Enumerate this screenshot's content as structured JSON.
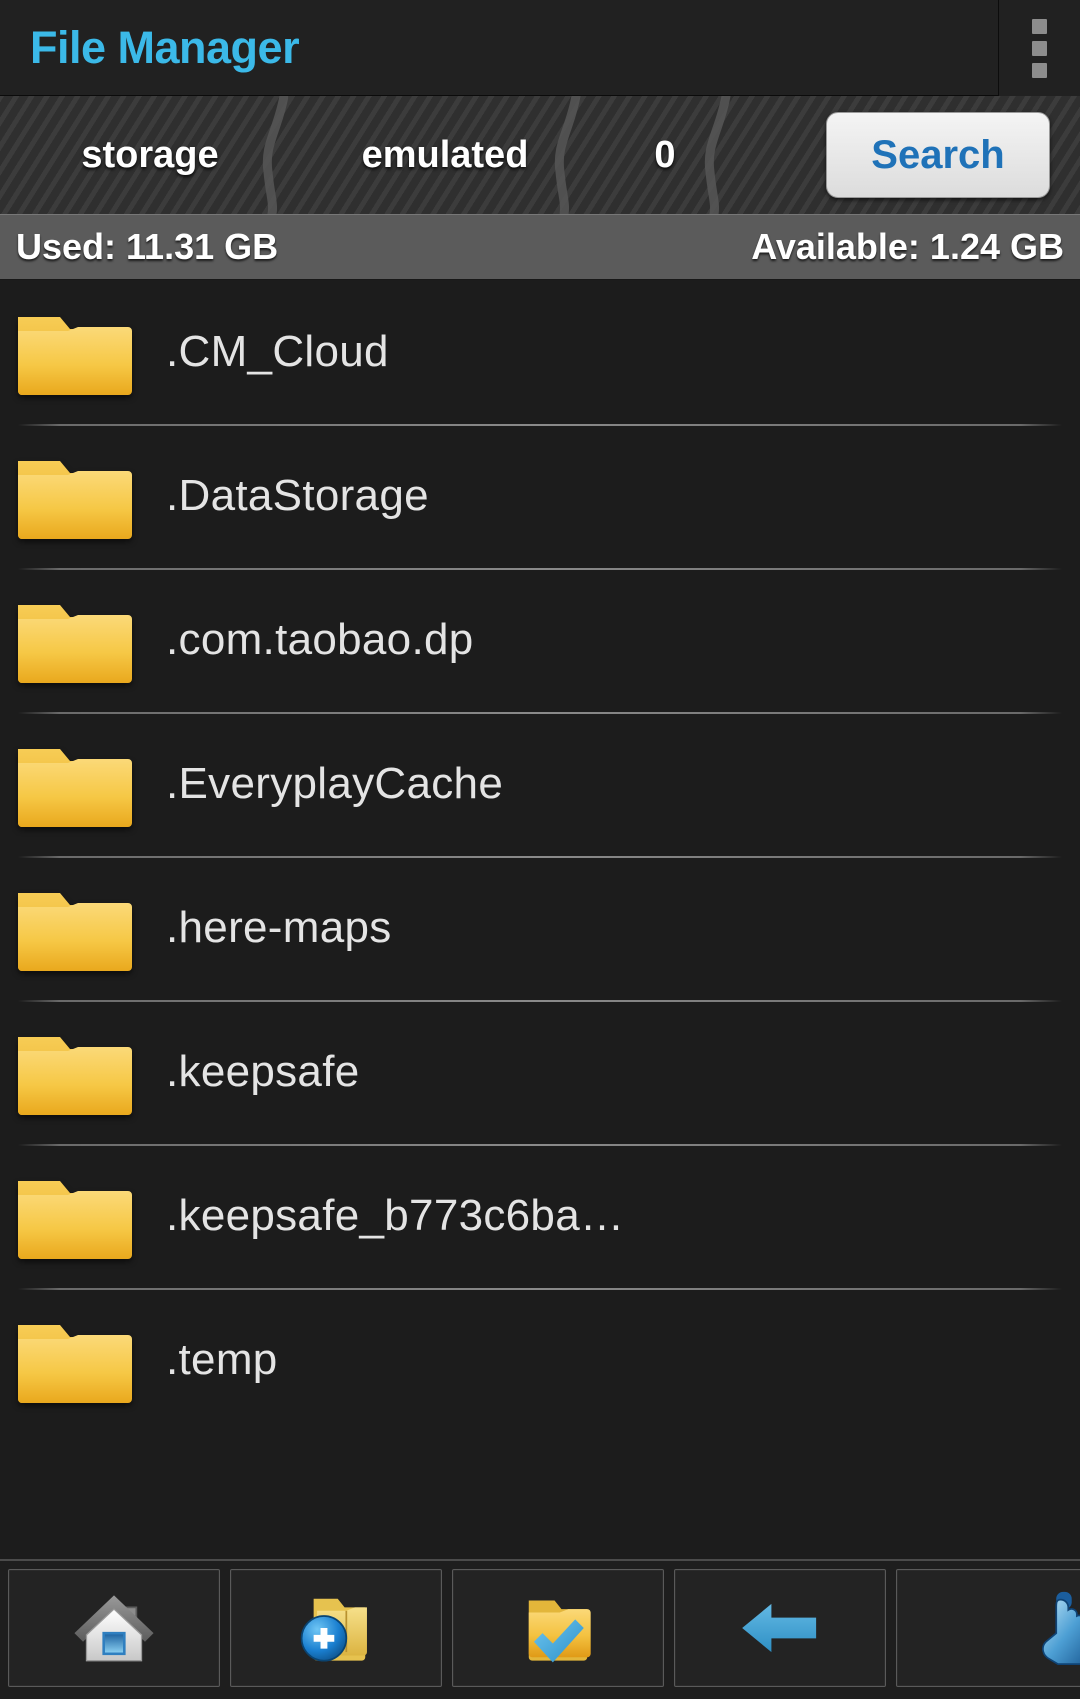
{
  "app": {
    "title": "File Manager",
    "accent_color": "#3bb9e8",
    "background_color": "#1c1c1c"
  },
  "titlebar": {
    "overflow_icon": "overflow-menu-icon"
  },
  "breadcrumb": {
    "segments": [
      {
        "label": "storage"
      },
      {
        "label": "emulated"
      },
      {
        "label": "0"
      }
    ],
    "search_label": "Search",
    "search_text_color": "#1f72b8"
  },
  "storage": {
    "used_label": "Used: 11.31 GB",
    "available_label": "Available: 1.24 GB"
  },
  "files": [
    {
      "name": ".CM_Cloud",
      "icon": "folder-icon"
    },
    {
      "name": ".DataStorage",
      "icon": "folder-icon"
    },
    {
      "name": ".com.taobao.dp",
      "icon": "folder-icon"
    },
    {
      "name": ".EveryplayCache",
      "icon": "folder-icon"
    },
    {
      "name": ".here-maps",
      "icon": "folder-icon"
    },
    {
      "name": ".keepsafe",
      "icon": "folder-icon"
    },
    {
      "name": ".keepsafe_b773c6ba…",
      "icon": "folder-icon"
    },
    {
      "name": ".temp",
      "icon": "folder-icon"
    }
  ],
  "toolbar": {
    "buttons": [
      {
        "name": "home",
        "icon": "home-icon"
      },
      {
        "name": "new-folder",
        "icon": "folder-add-icon"
      },
      {
        "name": "select-folder",
        "icon": "folder-check-icon"
      },
      {
        "name": "back",
        "icon": "arrow-left-icon"
      },
      {
        "name": "select-mode",
        "icon": "pointing-hand-icon"
      }
    ]
  }
}
